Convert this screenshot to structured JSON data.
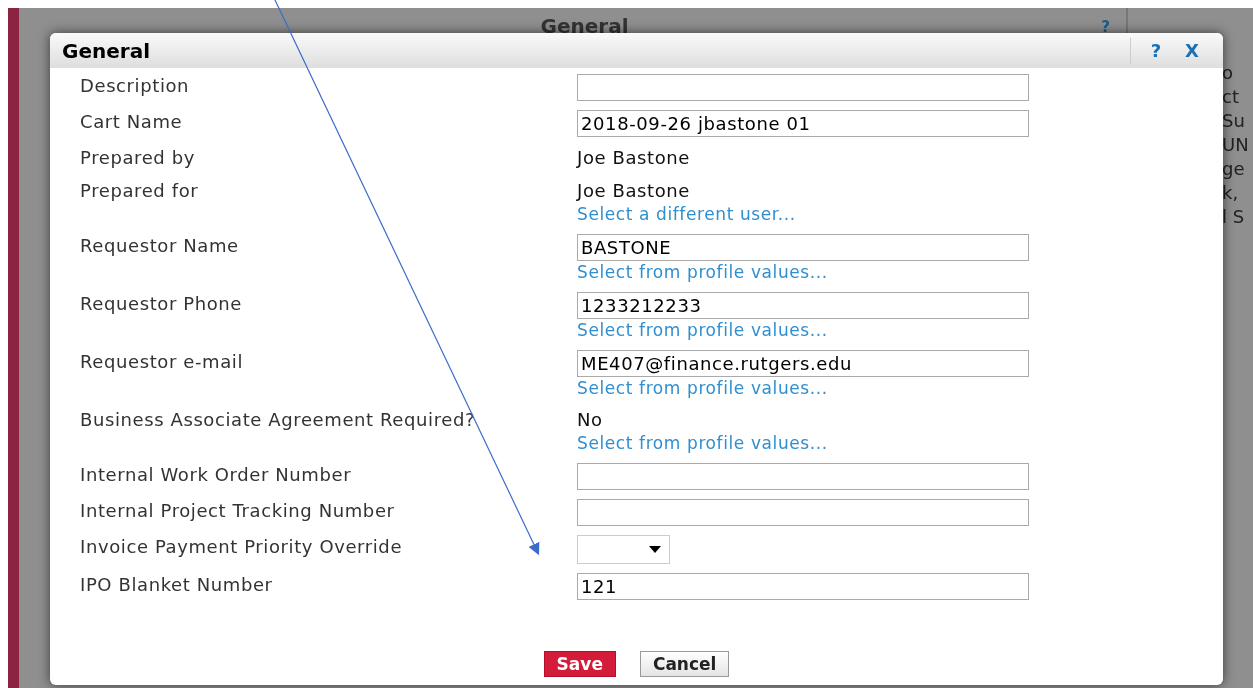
{
  "background": {
    "header_title": "General",
    "header_help": "?",
    "side_fragments": [
      "o",
      "ct",
      "Su",
      "UN",
      "ge",
      "k,",
      "l S"
    ]
  },
  "dialog": {
    "title": "General",
    "help": "?",
    "close": "X",
    "rows": [
      {
        "label": "Description",
        "kind": "input",
        "value": ""
      },
      {
        "label": "Cart Name",
        "kind": "input",
        "value": "2018-09-26 jbastone 01"
      },
      {
        "label": "Prepared by",
        "kind": "text",
        "value": "Joe Bastone"
      },
      {
        "label": "Prepared for",
        "kind": "text",
        "value": "Joe Bastone",
        "link": "Select a different user..."
      },
      {
        "label": "Requestor Name",
        "kind": "input",
        "value": "BASTONE",
        "link": "Select from profile values..."
      },
      {
        "label": "Requestor Phone",
        "kind": "input",
        "value": "1233212233",
        "link": "Select from profile values..."
      },
      {
        "label": "Requestor e-mail",
        "kind": "input",
        "value": "ME407@finance.rutgers.edu",
        "link": "Select from profile values..."
      },
      {
        "label": "Business Associate Agreement Required?",
        "kind": "text",
        "value": "No",
        "link": "Select from profile values..."
      },
      {
        "label": "Internal Work Order Number",
        "kind": "input",
        "value": ""
      },
      {
        "label": "Internal Project Tracking Number",
        "kind": "input",
        "value": ""
      },
      {
        "label": "Invoice Payment Priority Override",
        "kind": "select",
        "value": ""
      },
      {
        "label": "IPO Blanket Number",
        "kind": "input",
        "value": "121"
      }
    ],
    "buttons": [
      {
        "label": "Save",
        "kind": "primary"
      },
      {
        "label": "Cancel",
        "kind": "secondary"
      }
    ]
  }
}
